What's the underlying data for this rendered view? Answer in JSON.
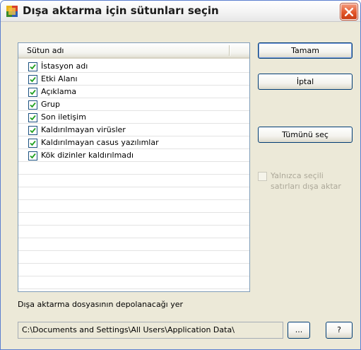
{
  "window": {
    "title": "Dışa aktarma için sütunları seçin",
    "title_icon": "avg-app-icon",
    "close_icon": "close-icon"
  },
  "columns_list": {
    "header": "Sütun adı",
    "items": [
      {
        "label": "İstasyon adı",
        "checked": true
      },
      {
        "label": "Etki Alanı",
        "checked": true
      },
      {
        "label": "Açıklama",
        "checked": true
      },
      {
        "label": "Grup",
        "checked": true
      },
      {
        "label": "Son iletişim",
        "checked": true
      },
      {
        "label": "Kaldırılmayan virüsler",
        "checked": true
      },
      {
        "label": "Kaldırılmayan casus yazılımlar",
        "checked": true
      },
      {
        "label": "Kök dizinler kaldırılmadı",
        "checked": true
      }
    ]
  },
  "buttons": {
    "ok": "Tamam",
    "cancel": "İptal",
    "select_all": "Tümünü seç",
    "browse": "...",
    "help": "?"
  },
  "only_selected": {
    "label": "Yalnızca seçili satırları dışa aktar",
    "checked": false,
    "disabled": true
  },
  "export_path": {
    "label": "Dışa aktarma dosyasının depolanacağı yer",
    "value": "C:\\Documents and Settings\\All Users\\Application Data\\"
  },
  "colors": {
    "window_bg": "#ece9d8",
    "border_blue": "#003c74",
    "close_red": "#e2572b"
  }
}
